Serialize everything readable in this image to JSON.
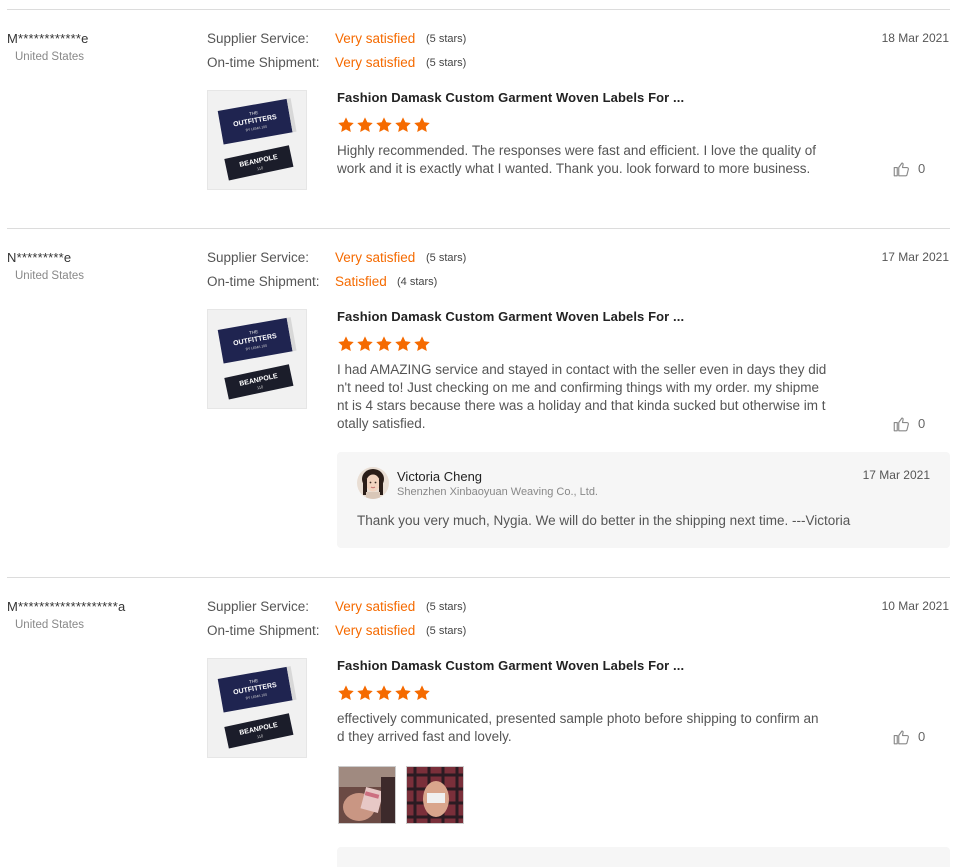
{
  "reviews": [
    {
      "user_name": "M************e",
      "country": "United States",
      "date": "18 Mar 2021",
      "supplier_service": {
        "label": "Supplier Service:",
        "value": "Very satisfied",
        "stars": "(5 stars)"
      },
      "shipment": {
        "label": "On-time Shipment:",
        "value": "Very satisfied",
        "stars": "(5 stars)"
      },
      "product_title": "Fashion Damask Custom Garment Woven Labels For ...",
      "rating": 5,
      "text_lines": [
        "Highly recommended. The responses were fast and efficient. I love the quality of",
        "work and it is exactly what I wanted. Thank you. look forward to more business."
      ],
      "likes": "0"
    },
    {
      "user_name": "N*********e",
      "country": "United States",
      "date": "17 Mar 2021",
      "supplier_service": {
        "label": "Supplier Service:",
        "value": "Very satisfied",
        "stars": "(5 stars)"
      },
      "shipment": {
        "label": "On-time Shipment:",
        "value": "Satisfied",
        "stars": "(4 stars)"
      },
      "product_title": "Fashion Damask Custom Garment Woven Labels For ...",
      "rating": 5,
      "text_lines": [
        "I had AMAZING service and stayed in contact with the seller even in days they did",
        "n't need to! Just checking on me and confirming things with my order. my shipme",
        "nt is 4 stars because there was a holiday and that kinda sucked but otherwise im t",
        "otally satisfied."
      ],
      "likes": "0",
      "reply": {
        "name": "Victoria Cheng",
        "company": "Shenzhen Xinbaoyuan Weaving Co., Ltd.",
        "date": "17 Mar 2021",
        "text": "Thank you very much, Nygia. We will do better in the shipping next time. ---Victoria"
      }
    },
    {
      "user_name": "M*******************a",
      "country": "United States",
      "date": "10 Mar 2021",
      "supplier_service": {
        "label": "Supplier Service:",
        "value": "Very satisfied",
        "stars": "(5 stars)"
      },
      "shipment": {
        "label": "On-time Shipment:",
        "value": "Very satisfied",
        "stars": "(5 stars)"
      },
      "product_title": "Fashion Damask Custom Garment Woven Labels For ...",
      "rating": 5,
      "text_lines": [
        "effectively communicated, presented sample photo before shipping to confirm an",
        "d they arrived fast and lovely."
      ],
      "likes": "0"
    }
  ],
  "label_art": {
    "line1": "THE",
    "line2": "OUTFITTERS",
    "line3": "BY LEMA 100",
    "line4": "BEANPOLE",
    "line5": "110"
  },
  "colors": {
    "accent": "#f56a00",
    "rule": "#dcdcdc",
    "label_navy": "#1f2450"
  }
}
